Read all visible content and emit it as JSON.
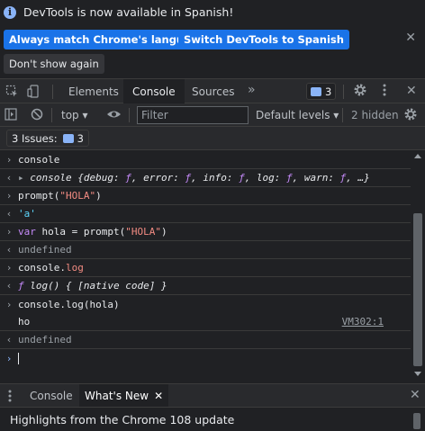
{
  "infobar": {
    "message": "DevTools is now available in Spanish!",
    "match_label": "Always match Chrome's language",
    "switch_label": "Switch DevTools to Spanish",
    "dont_show_label": "Don't show again",
    "close_glyph": "✕"
  },
  "tabs": {
    "items": [
      "Elements",
      "Console",
      "Sources"
    ],
    "active": "Console",
    "more_glyph": "»",
    "issue_count": "3"
  },
  "console_toolbar": {
    "context": "top",
    "filter_placeholder": "Filter",
    "levels_label": "Default levels",
    "hidden_label": "2 hidden",
    "issues_label": "3 Issues:",
    "issues_count": "3"
  },
  "console_lines": {
    "l1": "console",
    "l2_obj": "console",
    "l2_a": "{debug: ",
    "l2_f": "ƒ",
    "l2_b": ", error: ",
    "l2_c": ", info: ",
    "l2_d": ", log: ",
    "l2_e": ", warn: ",
    "l2_end": ", …}",
    "l3_fn": "prompt(",
    "l3_str": "\"HOLA\"",
    "l3_close": ")",
    "l4": "'a'",
    "l5_var": "var",
    "l5_mid": " hola = prompt(",
    "l5_str": "\"HOLA\"",
    "l5_close": ")",
    "l6": "undefined",
    "l7_obj": "console.",
    "l7_prop": "log",
    "l8_f": "ƒ",
    "l8_rest": " log() { [native code] }",
    "l9": "console.log(hola)",
    "l10": "ho",
    "l10_link": "VM302:1",
    "l11": "undefined"
  },
  "drawer": {
    "tab_console": "Console",
    "tab_whatsnew": "What's New",
    "headline": "Highlights from the Chrome 108 update"
  },
  "colors": {
    "accent": "#1a73e8",
    "background": "#202124",
    "string": "#f28b82",
    "keyword": "#c58af9"
  }
}
